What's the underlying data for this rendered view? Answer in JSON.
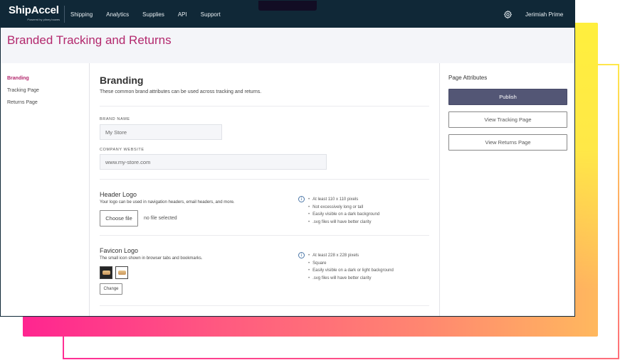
{
  "app": {
    "brand_name": "ShipAccel",
    "brand_tagline": "Powered by pitney bowes",
    "nav": [
      {
        "label": "Shipping"
      },
      {
        "label": "Analytics"
      },
      {
        "label": "Supplies"
      },
      {
        "label": "API"
      },
      {
        "label": "Support"
      }
    ],
    "settings_icon": "gear-icon",
    "user_name": "Jerimiah Prime"
  },
  "page": {
    "title": "Branded Tracking and Returns"
  },
  "sidebar": {
    "items": [
      {
        "label": "Branding",
        "active": true
      },
      {
        "label": "Tracking Page",
        "active": false
      },
      {
        "label": "Returns Page",
        "active": false
      }
    ]
  },
  "main": {
    "heading": "Branding",
    "description": "These common brand attributes can be used across tracking and returns.",
    "brand_name": {
      "label": "BRAND NAME",
      "value": "My Store"
    },
    "company_website": {
      "label": "COMPANY WEBSITE",
      "value": "www.my-store.com"
    },
    "header_logo": {
      "title": "Header Logo",
      "description": "Your logo can be used in navigation headers, email headers, and more.",
      "choose_file_label": "Choose file",
      "file_status": "no file selected",
      "tips": [
        "At least 110 x 110 pixels",
        "Not excessively long or tall",
        "Easily visible on a dark background",
        ".svg files will have better clarity"
      ]
    },
    "favicon_logo": {
      "title": "Favicon Logo",
      "description": "The small icon shown in browser tabs and bookmarks.",
      "change_label": "Change",
      "tips": [
        "At least 228 x 228 pixels",
        "Square",
        "Easily visible on a dark or light background",
        ".svg files will have better clarity"
      ]
    }
  },
  "right_panel": {
    "title": "Page Attributes",
    "publish_label": "Publish",
    "view_tracking_label": "View Tracking Page",
    "view_returns_label": "View Returns Page"
  },
  "colors": {
    "topbar": "#102837",
    "accent": "#b3286d",
    "primary_button": "#535675",
    "info": "#4d78a8"
  }
}
